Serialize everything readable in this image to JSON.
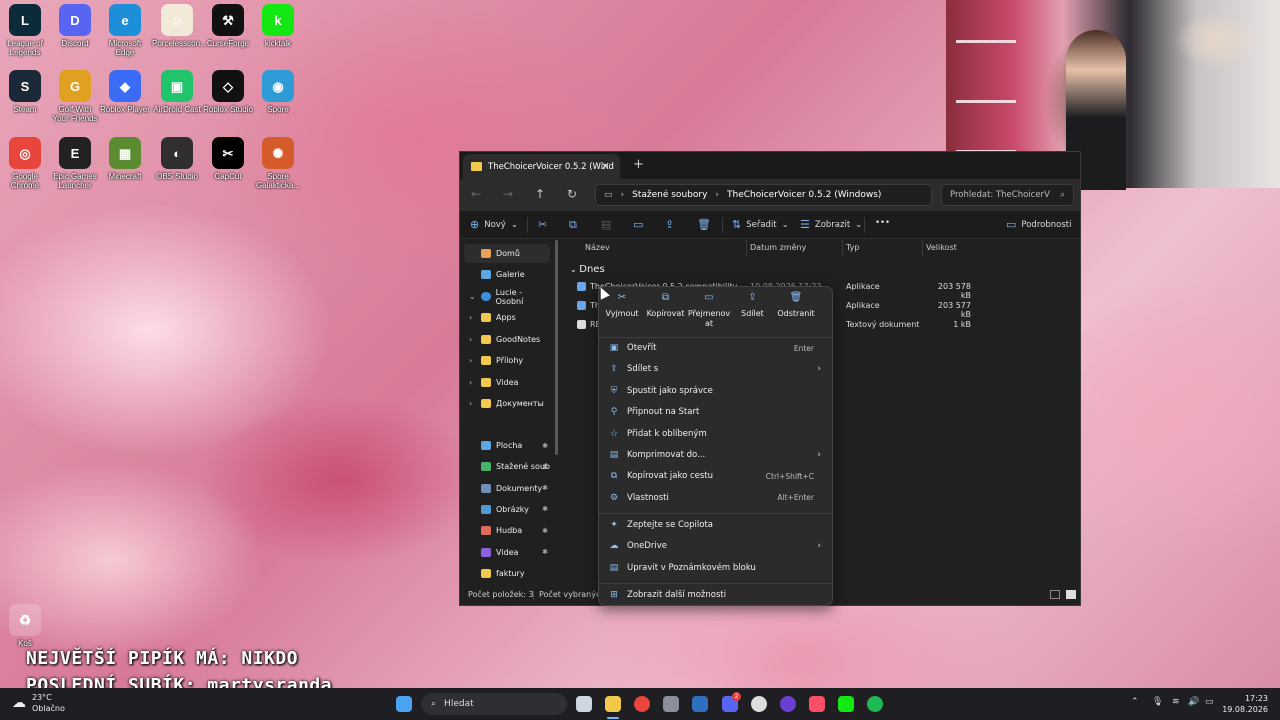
{
  "desktop": {
    "icons": [
      {
        "label": "League of Legends",
        "color": "#0b2a3a",
        "glyph": "L"
      },
      {
        "label": "Discord",
        "color": "#5865f2",
        "glyph": "D"
      },
      {
        "label": "Microsoft Edge",
        "color": "#1d8fd8",
        "glyph": "e"
      },
      {
        "label": "Porcelesscon...",
        "color": "#f3e9d9",
        "glyph": "☺"
      },
      {
        "label": "CurseForge",
        "color": "#111111",
        "glyph": "⚒"
      },
      {
        "label": "kicktalk",
        "color": "#13e813",
        "glyph": "k"
      },
      {
        "label": "Steam",
        "color": "#1b2838",
        "glyph": "S"
      },
      {
        "label": "Golf With Your Friends",
        "color": "#e0a020",
        "glyph": "G"
      },
      {
        "label": "Roblox Player",
        "color": "#3b6cf5",
        "glyph": "◆"
      },
      {
        "label": "AirDroid Cast",
        "color": "#21c36b",
        "glyph": "▣"
      },
      {
        "label": "Roblox Studio",
        "color": "#111111",
        "glyph": "◇"
      },
      {
        "label": "Spore",
        "color": "#2c9bd6",
        "glyph": "◉"
      },
      {
        "label": "Google Chrome",
        "color": "#e8453c",
        "glyph": "◎"
      },
      {
        "label": "Epic Games Launcher",
        "color": "#222222",
        "glyph": "E"
      },
      {
        "label": "Minecraft",
        "color": "#5b8c32",
        "glyph": "▦"
      },
      {
        "label": "OBS Studio",
        "color": "#302e31",
        "glyph": "◐"
      },
      {
        "label": "CapCut",
        "color": "#000000",
        "glyph": "✂"
      },
      {
        "label": "Spore Galaktická...",
        "color": "#d65b2a",
        "glyph": "✺"
      }
    ],
    "recycle_bin": "Koš"
  },
  "overlay": {
    "line1": "NEJVĚTŠÍ PIPÍK MÁ: NIKDO",
    "line2": "POSLEDNÍ SUBÍK: martysranda"
  },
  "explorer": {
    "tab_title": "TheChoicerVoicer 0.5.2 (Wind",
    "breadcrumb": [
      "Stažené soubory",
      "TheChoicerVoicer 0.5.2 (Windows)"
    ],
    "search_placeholder": "Prohledat: TheChoicerV",
    "toolbar": {
      "new": "Nový",
      "sort": "Seřadit",
      "view": "Zobrazit",
      "more": "•••",
      "details": "Podrobnosti"
    },
    "nav": {
      "home": "Domů",
      "gallery": "Galerie",
      "onedrive": "Lucie - Osobní",
      "folders": [
        "Apps",
        "GoodNotes",
        "Přílohy",
        "Videa",
        "Документы"
      ],
      "quick": [
        {
          "label": "Plocha",
          "color": "#5aa8e6"
        },
        {
          "label": "Stažené soub",
          "color": "#49b36b"
        },
        {
          "label": "Dokumenty",
          "color": "#6f8fb8"
        },
        {
          "label": "Obrázky",
          "color": "#4f9bd9"
        },
        {
          "label": "Hudba",
          "color": "#e06b5a"
        },
        {
          "label": "Videa",
          "color": "#8b62d9"
        },
        {
          "label": "faktury",
          "color": "#f2c94c"
        }
      ]
    },
    "columns": {
      "name": "Název",
      "date": "Datum změny",
      "type": "Typ",
      "size": "Velikost"
    },
    "group": "Dnes",
    "rows": [
      {
        "name": "TheChoicerVoicer 0.5.2 compatibility",
        "date": "19.08.2026 17:22",
        "type": "Aplikace",
        "size": "203 578 kB"
      },
      {
        "name": "Th",
        "date": "",
        "type": "Aplikace",
        "size": "203 577 kB"
      },
      {
        "name": "RE",
        "date": "",
        "type": "Textový dokument",
        "size": "1 kB"
      }
    ],
    "status": {
      "count": "Počet položek: 3",
      "selected": "Počet vybraných"
    }
  },
  "context_menu": {
    "top_actions": [
      {
        "label": "Vyjmout",
        "icon": "cut-icon",
        "glyph": "✂"
      },
      {
        "label": "Kopírovat",
        "icon": "copy-icon",
        "glyph": "⧉"
      },
      {
        "label": "Přejmenov at",
        "icon": "rename-icon",
        "glyph": "▭"
      },
      {
        "label": "Sdílet",
        "icon": "share-icon",
        "glyph": "⇪"
      },
      {
        "label": "Odstranit",
        "icon": "trash-icon",
        "glyph": "🗑"
      }
    ],
    "items": [
      {
        "label": "Otevřít",
        "shortcut": "Enter",
        "glyph": "▣",
        "submenu": false
      },
      {
        "label": "Sdílet s",
        "shortcut": "",
        "glyph": "⇪",
        "submenu": true
      },
      {
        "label": "Spustit jako správce",
        "shortcut": "",
        "glyph": "⛨",
        "submenu": false
      },
      {
        "label": "Připnout na Start",
        "shortcut": "",
        "glyph": "⚲",
        "submenu": false
      },
      {
        "label": "Přidat k oblíbeným",
        "shortcut": "",
        "glyph": "☆",
        "submenu": false
      },
      {
        "label": "Komprimovat do...",
        "shortcut": "",
        "glyph": "▤",
        "submenu": true
      },
      {
        "label": "Kopírovat jako cestu",
        "shortcut": "Ctrl+Shift+C",
        "glyph": "⧉",
        "submenu": false
      },
      {
        "label": "Vlastnosti",
        "shortcut": "Alt+Enter",
        "glyph": "⚙",
        "submenu": false
      }
    ],
    "items2": [
      {
        "label": "Zeptejte se Copilota",
        "glyph": "✦",
        "submenu": false
      },
      {
        "label": "OneDrive",
        "glyph": "☁",
        "submenu": true
      },
      {
        "label": "Upravit v Poznámkovém bloku",
        "glyph": "▤",
        "submenu": false
      }
    ],
    "more": {
      "label": "Zobrazit další možnosti",
      "glyph": "⊞"
    }
  },
  "taskbar": {
    "weather_temp": "23°C",
    "weather_desc": "Oblačno",
    "search": "Hledat",
    "time": "17:23",
    "date": "19.08.2026",
    "badge": "2"
  }
}
